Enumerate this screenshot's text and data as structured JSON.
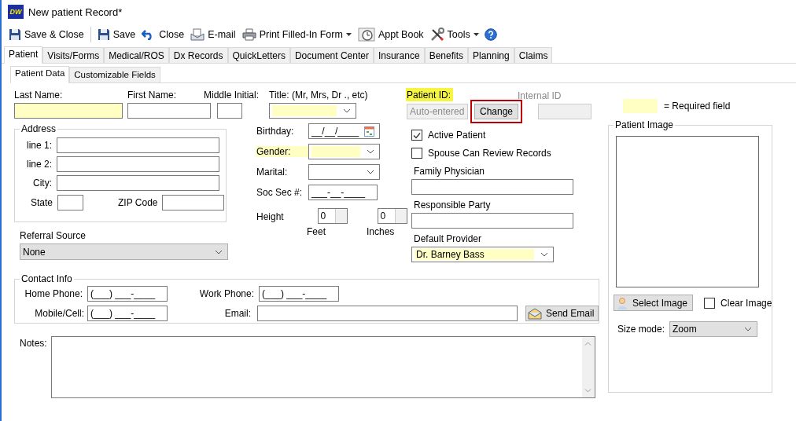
{
  "window": {
    "title": "New patient Record*",
    "logo": "DW"
  },
  "toolbar": [
    {
      "kind": "save-close",
      "label": "Save & Close",
      "dropdown": false
    },
    {
      "kind": "separator"
    },
    {
      "kind": "save",
      "label": "Save",
      "dropdown": false
    },
    {
      "kind": "undo",
      "label": "Close",
      "dropdown": false
    },
    {
      "kind": "email",
      "label": "E-mail",
      "dropdown": false
    },
    {
      "kind": "print",
      "label": "Print Filled-In Form",
      "dropdown": true
    },
    {
      "kind": "clock",
      "label": "Appt Book",
      "dropdown": false
    },
    {
      "kind": "tools",
      "label": "Tools",
      "dropdown": true
    },
    {
      "kind": "help",
      "dropdown": false
    }
  ],
  "tabs": [
    {
      "label": "Patient",
      "selected": true
    },
    {
      "label": "Visits/Forms",
      "selected": false
    },
    {
      "label": "Medical/ROS",
      "selected": false
    },
    {
      "label": "Dx Records",
      "selected": false
    },
    {
      "label": "QuickLetters",
      "selected": false
    },
    {
      "label": "Document Center",
      "selected": false
    },
    {
      "label": "Insurance",
      "selected": false
    },
    {
      "label": "Benefits",
      "selected": false
    },
    {
      "label": "Planning",
      "selected": false
    },
    {
      "label": "Claims",
      "selected": false
    }
  ],
  "subtabs": [
    {
      "label": "Patient Data",
      "selected": true
    },
    {
      "label": "Customizable Fields",
      "selected": false
    }
  ],
  "name_fields": [
    {
      "label": "Last Name:",
      "kind": "text",
      "required": true
    },
    {
      "label": "First Name:",
      "kind": "text",
      "required": false
    },
    {
      "label": "Middle Initial:",
      "kind": "text",
      "required": false
    },
    {
      "label": "Title: (Mr, Mrs, Dr ., etc)",
      "kind": "dropdown",
      "required": true
    }
  ],
  "address": {
    "title": "Address",
    "lines": [
      "line 1:",
      "line 2:",
      "City:"
    ],
    "state_label": "State",
    "zip_label": "ZIP Code"
  },
  "referral": {
    "label": "Referral Source",
    "value": "None"
  },
  "personal": [
    {
      "kind": "date",
      "label": "Birthday:",
      "value": "__/__/____",
      "required": false
    },
    {
      "kind": "dropdown",
      "label": "Gender:",
      "required": true
    },
    {
      "kind": "dropdown",
      "label": "Marital:",
      "required": false
    },
    {
      "kind": "masked",
      "label": "Soc Sec #:",
      "value": "___-__-____",
      "required": false
    }
  ],
  "height": {
    "label": "Height",
    "feet": {
      "value": "0",
      "label": "Feet"
    },
    "inches": {
      "value": "0",
      "label": "Inches"
    }
  },
  "patient_id": {
    "label": "Patient ID:",
    "placeholder": "Auto-entered",
    "button": "Change",
    "button_highlighted": true,
    "internal_label": "Internal ID"
  },
  "checkboxes": [
    {
      "label": "Active Patient",
      "checked": true
    },
    {
      "label": "Spouse Can Review Records",
      "checked": false
    }
  ],
  "physician_fields": [
    {
      "label": "Family Physician",
      "kind": "text",
      "required": false
    },
    {
      "label": "Responsible Party",
      "kind": "text",
      "required": false
    },
    {
      "label": "Default Provider",
      "kind": "dropdown",
      "value": "Dr. Barney Bass",
      "required": true
    }
  ],
  "legend": "= Required field",
  "patient_image": {
    "title": "Patient Image",
    "select_button": "Select Image",
    "clear_label": "Clear Image",
    "clear_checked": false,
    "size_label": "Size mode:",
    "size_value": "Zoom"
  },
  "contact": {
    "title": "Contact Info",
    "home_label": "Home Phone:",
    "home_value": "(___) ___-____",
    "work_label": "Work Phone:",
    "work_value": "(___) ___-____",
    "mobile_label": "Mobile/Cell:",
    "mobile_value": "(___) ___-____",
    "email_label": "Email:",
    "send_button": "Send Email"
  },
  "notes": {
    "label": "Notes:"
  }
}
